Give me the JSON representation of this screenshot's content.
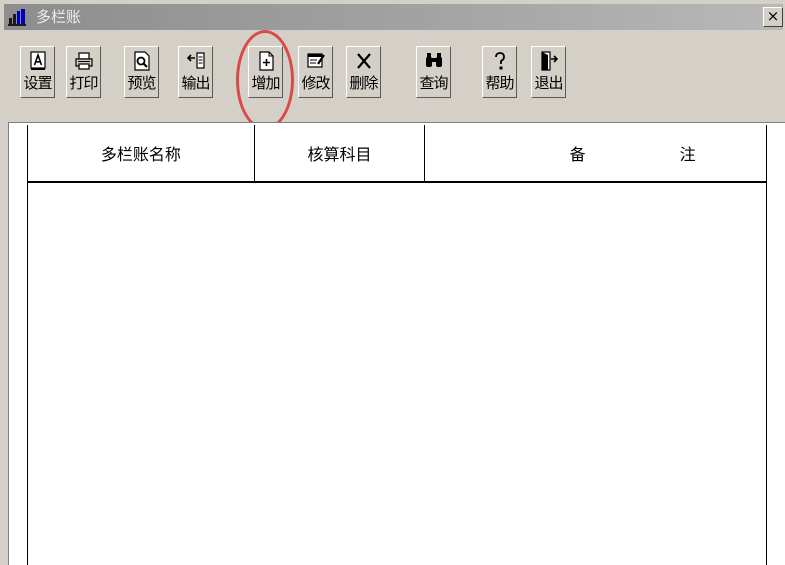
{
  "window": {
    "title": "多栏账",
    "close_label": "×"
  },
  "toolbar": {
    "buttons": [
      {
        "id": "settings",
        "label": "设置",
        "icon": "settings-letter-a-icon"
      },
      {
        "id": "print",
        "label": "打印",
        "icon": "printer-icon"
      },
      {
        "id": "preview",
        "label": "预览",
        "icon": "preview-magnifier-icon"
      },
      {
        "id": "export",
        "label": "输出",
        "icon": "export-arrow-icon"
      },
      {
        "id": "add",
        "label": "增加",
        "icon": "add-document-icon",
        "highlighted": true
      },
      {
        "id": "edit",
        "label": "修改",
        "icon": "edit-form-icon"
      },
      {
        "id": "delete",
        "label": "删除",
        "icon": "delete-x-icon"
      },
      {
        "id": "query",
        "label": "查询",
        "icon": "binoculars-icon"
      },
      {
        "id": "help",
        "label": "帮助",
        "icon": "help-question-icon"
      },
      {
        "id": "exit",
        "label": "退出",
        "icon": "exit-door-icon"
      }
    ]
  },
  "table": {
    "columns": [
      {
        "label": "多栏账名称"
      },
      {
        "label": "核算科目"
      },
      {
        "label_part1": "备",
        "label_part2": "注"
      }
    ],
    "rows": []
  },
  "colors": {
    "title_bar": "#9a9a9a",
    "highlight_ring": "#d94a4a",
    "face": "#d4d0c8"
  }
}
